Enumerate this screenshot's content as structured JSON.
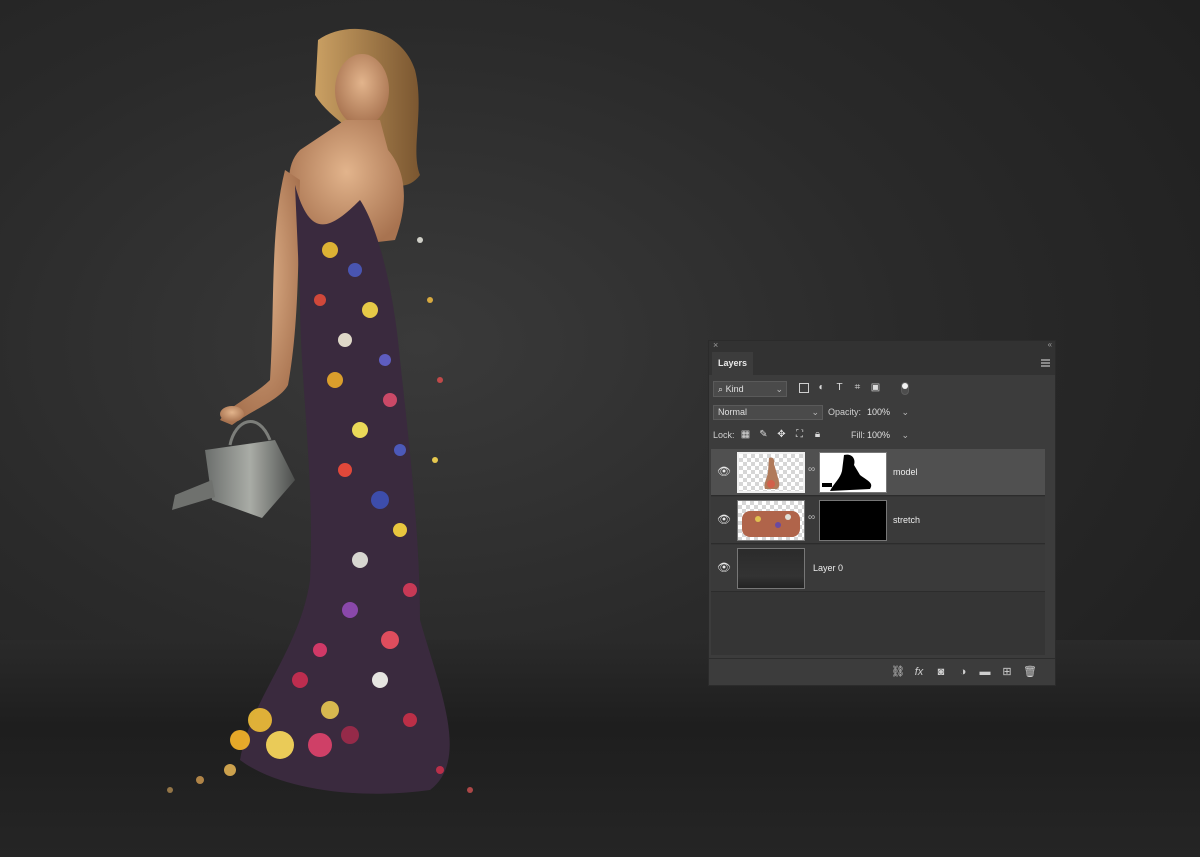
{
  "layers_panel": {
    "tab_label": "Layers",
    "filter": {
      "kind_label": "Kind"
    },
    "blend_mode": "Normal",
    "opacity_label": "Opacity:",
    "opacity_value": "100%",
    "lock_label": "Lock:",
    "fill_label": "Fill:",
    "fill_value": "100%",
    "layers": [
      {
        "name": "model",
        "selected": true,
        "visible": true,
        "has_mask": true,
        "mask_color": "#ffffff"
      },
      {
        "name": "stretch",
        "selected": false,
        "visible": true,
        "has_mask": true,
        "mask_color": "#000000"
      },
      {
        "name": "Layer 0",
        "selected": false,
        "visible": true,
        "has_mask": false
      }
    ],
    "footer_icons": [
      "link-layers-icon",
      "fx-icon",
      "add-mask-icon",
      "adjustment-layer-icon",
      "group-folder-icon",
      "new-layer-icon",
      "trash-icon"
    ]
  },
  "colors": {
    "panel_bg": "#3c3c3c",
    "selected_layer_bg": "#505050",
    "canvas_bg": "#2a2a2a"
  }
}
